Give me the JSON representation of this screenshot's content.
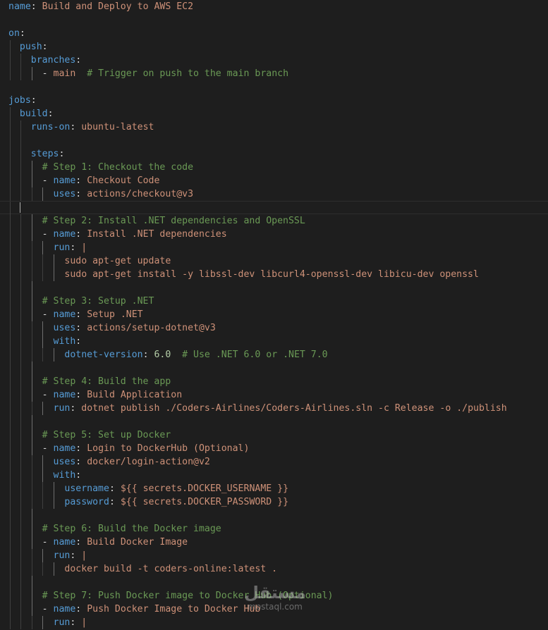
{
  "theme": {
    "background": "#1e1e1e",
    "key": "#569cd6",
    "string": "#ce9178",
    "comment": "#6a9955",
    "number": "#b5cea8",
    "plain": "#d4d4d4"
  },
  "editor": {
    "language": "yaml",
    "lines": [
      {
        "indent": 0,
        "tokens": [
          {
            "t": "key",
            "v": "name"
          },
          {
            "t": "plain",
            "v": ": "
          },
          {
            "t": "string",
            "v": "Build and Deploy to AWS EC2"
          }
        ]
      },
      {
        "indent": 0,
        "tokens": []
      },
      {
        "indent": 0,
        "tokens": [
          {
            "t": "key",
            "v": "on"
          },
          {
            "t": "plain",
            "v": ":"
          }
        ]
      },
      {
        "indent": 1,
        "tokens": [
          {
            "t": "key",
            "v": "push"
          },
          {
            "t": "plain",
            "v": ":"
          }
        ]
      },
      {
        "indent": 2,
        "tokens": [
          {
            "t": "key",
            "v": "branches"
          },
          {
            "t": "plain",
            "v": ":"
          }
        ]
      },
      {
        "indent": 3,
        "tokens": [
          {
            "t": "plain",
            "v": "- "
          },
          {
            "t": "string",
            "v": "main"
          },
          {
            "t": "plain",
            "v": "  "
          },
          {
            "t": "comment",
            "v": "# Trigger on push to the main branch"
          }
        ]
      },
      {
        "indent": 0,
        "tokens": []
      },
      {
        "indent": 0,
        "tokens": [
          {
            "t": "key",
            "v": "jobs"
          },
          {
            "t": "plain",
            "v": ":"
          }
        ]
      },
      {
        "indent": 1,
        "tokens": [
          {
            "t": "key",
            "v": "build"
          },
          {
            "t": "plain",
            "v": ":"
          }
        ]
      },
      {
        "indent": 2,
        "tokens": [
          {
            "t": "key",
            "v": "runs-on"
          },
          {
            "t": "plain",
            "v": ": "
          },
          {
            "t": "string",
            "v": "ubuntu-latest"
          }
        ]
      },
      {
        "indent": 2,
        "tokens": []
      },
      {
        "indent": 2,
        "tokens": [
          {
            "t": "key",
            "v": "steps"
          },
          {
            "t": "plain",
            "v": ":"
          }
        ]
      },
      {
        "indent": 3,
        "tokens": [
          {
            "t": "comment",
            "v": "# Step 1: Checkout the code"
          }
        ]
      },
      {
        "indent": 3,
        "tokens": [
          {
            "t": "plain",
            "v": "- "
          },
          {
            "t": "key",
            "v": "name"
          },
          {
            "t": "plain",
            "v": ": "
          },
          {
            "t": "string",
            "v": "Checkout Code"
          }
        ]
      },
      {
        "indent": 4,
        "tokens": [
          {
            "t": "key",
            "v": "uses"
          },
          {
            "t": "plain",
            "v": ": "
          },
          {
            "t": "string",
            "v": "actions/checkout@v3"
          }
        ]
      },
      {
        "indent": 1,
        "current": true,
        "tokens": []
      },
      {
        "indent": 3,
        "tokens": [
          {
            "t": "comment",
            "v": "# Step 2: Install .NET dependencies and OpenSSL"
          }
        ]
      },
      {
        "indent": 3,
        "tokens": [
          {
            "t": "plain",
            "v": "- "
          },
          {
            "t": "key",
            "v": "name"
          },
          {
            "t": "plain",
            "v": ": "
          },
          {
            "t": "string",
            "v": "Install .NET dependencies"
          }
        ]
      },
      {
        "indent": 4,
        "tokens": [
          {
            "t": "key",
            "v": "run"
          },
          {
            "t": "plain",
            "v": ": "
          },
          {
            "t": "string",
            "v": "|"
          }
        ]
      },
      {
        "indent": 5,
        "tokens": [
          {
            "t": "string",
            "v": "sudo apt-get update"
          }
        ]
      },
      {
        "indent": 5,
        "tokens": [
          {
            "t": "string",
            "v": "sudo apt-get install -y libssl-dev libcurl4-openssl-dev libicu-dev openssl"
          }
        ]
      },
      {
        "indent": 3,
        "tokens": []
      },
      {
        "indent": 3,
        "tokens": [
          {
            "t": "comment",
            "v": "# Step 3: Setup .NET"
          }
        ]
      },
      {
        "indent": 3,
        "tokens": [
          {
            "t": "plain",
            "v": "- "
          },
          {
            "t": "key",
            "v": "name"
          },
          {
            "t": "plain",
            "v": ": "
          },
          {
            "t": "string",
            "v": "Setup .NET"
          }
        ]
      },
      {
        "indent": 4,
        "tokens": [
          {
            "t": "key",
            "v": "uses"
          },
          {
            "t": "plain",
            "v": ": "
          },
          {
            "t": "string",
            "v": "actions/setup-dotnet@v3"
          }
        ]
      },
      {
        "indent": 4,
        "tokens": [
          {
            "t": "key",
            "v": "with"
          },
          {
            "t": "plain",
            "v": ":"
          }
        ]
      },
      {
        "indent": 5,
        "tokens": [
          {
            "t": "key",
            "v": "dotnet-version"
          },
          {
            "t": "plain",
            "v": ": "
          },
          {
            "t": "number",
            "v": "6.0"
          },
          {
            "t": "plain",
            "v": "  "
          },
          {
            "t": "comment",
            "v": "# Use .NET 6.0 or .NET 7.0"
          }
        ]
      },
      {
        "indent": 3,
        "tokens": []
      },
      {
        "indent": 3,
        "tokens": [
          {
            "t": "comment",
            "v": "# Step 4: Build the app"
          }
        ]
      },
      {
        "indent": 3,
        "tokens": [
          {
            "t": "plain",
            "v": "- "
          },
          {
            "t": "key",
            "v": "name"
          },
          {
            "t": "plain",
            "v": ": "
          },
          {
            "t": "string",
            "v": "Build Application"
          }
        ]
      },
      {
        "indent": 4,
        "tokens": [
          {
            "t": "key",
            "v": "run"
          },
          {
            "t": "plain",
            "v": ": "
          },
          {
            "t": "string",
            "v": "dotnet publish ./Coders-Airlines/Coders-Airlines.sln -c Release -o ./publish"
          }
        ]
      },
      {
        "indent": 3,
        "tokens": []
      },
      {
        "indent": 3,
        "tokens": [
          {
            "t": "comment",
            "v": "# Step 5: Set up Docker"
          }
        ]
      },
      {
        "indent": 3,
        "tokens": [
          {
            "t": "plain",
            "v": "- "
          },
          {
            "t": "key",
            "v": "name"
          },
          {
            "t": "plain",
            "v": ": "
          },
          {
            "t": "string",
            "v": "Login to DockerHub (Optional)"
          }
        ]
      },
      {
        "indent": 4,
        "tokens": [
          {
            "t": "key",
            "v": "uses"
          },
          {
            "t": "plain",
            "v": ": "
          },
          {
            "t": "string",
            "v": "docker/login-action@v2"
          }
        ]
      },
      {
        "indent": 4,
        "tokens": [
          {
            "t": "key",
            "v": "with"
          },
          {
            "t": "plain",
            "v": ":"
          }
        ]
      },
      {
        "indent": 5,
        "tokens": [
          {
            "t": "key",
            "v": "username"
          },
          {
            "t": "plain",
            "v": ": "
          },
          {
            "t": "string",
            "v": "${{ secrets.DOCKER_USERNAME }}"
          }
        ]
      },
      {
        "indent": 5,
        "tokens": [
          {
            "t": "key",
            "v": "password"
          },
          {
            "t": "plain",
            "v": ": "
          },
          {
            "t": "string",
            "v": "${{ secrets.DOCKER_PASSWORD }}"
          }
        ]
      },
      {
        "indent": 3,
        "tokens": []
      },
      {
        "indent": 3,
        "tokens": [
          {
            "t": "comment",
            "v": "# Step 6: Build the Docker image"
          }
        ]
      },
      {
        "indent": 3,
        "tokens": [
          {
            "t": "plain",
            "v": "- "
          },
          {
            "t": "key",
            "v": "name"
          },
          {
            "t": "plain",
            "v": ": "
          },
          {
            "t": "string",
            "v": "Build Docker Image"
          }
        ]
      },
      {
        "indent": 4,
        "tokens": [
          {
            "t": "key",
            "v": "run"
          },
          {
            "t": "plain",
            "v": ": "
          },
          {
            "t": "string",
            "v": "|"
          }
        ]
      },
      {
        "indent": 5,
        "tokens": [
          {
            "t": "string",
            "v": "docker build -t coders-online:latest ."
          }
        ]
      },
      {
        "indent": 3,
        "tokens": []
      },
      {
        "indent": 3,
        "tokens": [
          {
            "t": "comment",
            "v": "# Step 7: Push Docker image to Docker Hub (Optional)"
          }
        ]
      },
      {
        "indent": 3,
        "tokens": [
          {
            "t": "plain",
            "v": "- "
          },
          {
            "t": "key",
            "v": "name"
          },
          {
            "t": "plain",
            "v": ": "
          },
          {
            "t": "string",
            "v": "Push Docker Image to Docker Hub"
          }
        ]
      },
      {
        "indent": 4,
        "tokens": [
          {
            "t": "key",
            "v": "run"
          },
          {
            "t": "plain",
            "v": ": "
          },
          {
            "t": "string",
            "v": "|"
          }
        ]
      }
    ]
  },
  "watermark": {
    "arabic": "مستقل",
    "url": "mostaql.com"
  }
}
